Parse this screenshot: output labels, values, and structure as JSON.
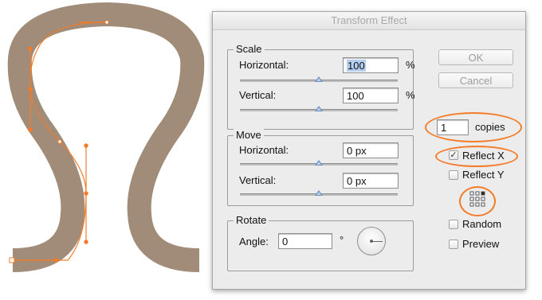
{
  "dialog": {
    "title": "Transform Effect",
    "scale": {
      "title": "Scale",
      "horizontal_label": "Horizontal:",
      "horizontal_value": "100",
      "horizontal_unit": "%",
      "vertical_label": "Vertical:",
      "vertical_value": "100",
      "vertical_unit": "%"
    },
    "move": {
      "title": "Move",
      "horizontal_label": "Horizontal:",
      "horizontal_value": "0 px",
      "vertical_label": "Vertical:",
      "vertical_value": "0 px"
    },
    "rotate": {
      "title": "Rotate",
      "angle_label": "Angle:",
      "angle_value": "0",
      "degree_symbol": "°"
    },
    "ok_label": "OK",
    "cancel_label": "Cancel",
    "copies_value": "1",
    "copies_label": "copies",
    "reflect_x": {
      "label": "Reflect X",
      "checked": true
    },
    "reflect_y": {
      "label": "Reflect Y",
      "checked": false
    },
    "random": {
      "label": "Random",
      "checked": false
    },
    "preview": {
      "label": "Preview",
      "checked": false
    }
  },
  "colors": {
    "shape_fill": "#a08c78",
    "highlight": "#f47b27",
    "dialog_bg": "#ececec"
  }
}
